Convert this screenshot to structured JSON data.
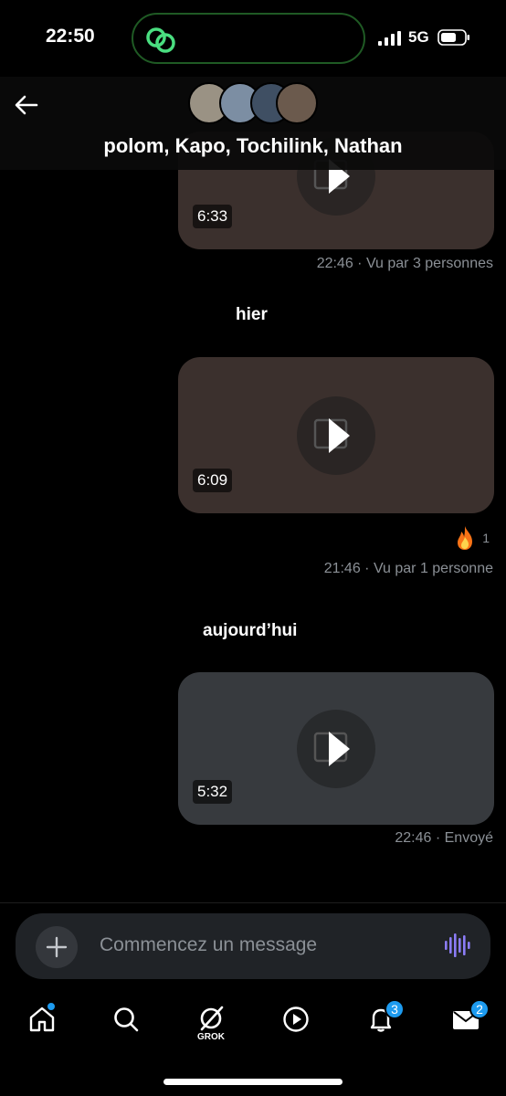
{
  "status_bar": {
    "time": "22:50",
    "network": "5G"
  },
  "header": {
    "title": "polom, Kapo, Tochilink, Nathan",
    "back_icon": "arrow-left-icon"
  },
  "messages": [
    {
      "type": "video",
      "duration": "6:33",
      "meta": "22:46 · Vu par 3 personnes",
      "thumb_color": "#3b302d"
    },
    {
      "type": "day",
      "label": "hier"
    },
    {
      "type": "video",
      "duration": "6:09",
      "meta": "21:46 · Vu par 1 personne",
      "reaction": {
        "emoji": "fire-icon",
        "count": "1"
      },
      "thumb_color": "#3b302d"
    },
    {
      "type": "day",
      "label": "aujourd’hui"
    },
    {
      "type": "video",
      "duration": "5:32",
      "meta": "22:46 · Envoyé",
      "thumb_color": "#373a3e"
    }
  ],
  "composer": {
    "placeholder": "Commencez un message"
  },
  "tabbar": {
    "items": [
      "home-icon",
      "search-icon",
      "grok-icon",
      "video-icon",
      "notifications-icon",
      "messages-icon"
    ],
    "grok_label": "GROK",
    "notifications_badge": "3",
    "messages_badge": "2"
  },
  "colors": {
    "accent": "#1d9bf0",
    "background": "#000000",
    "voice_accent": "#8b7cf6"
  }
}
